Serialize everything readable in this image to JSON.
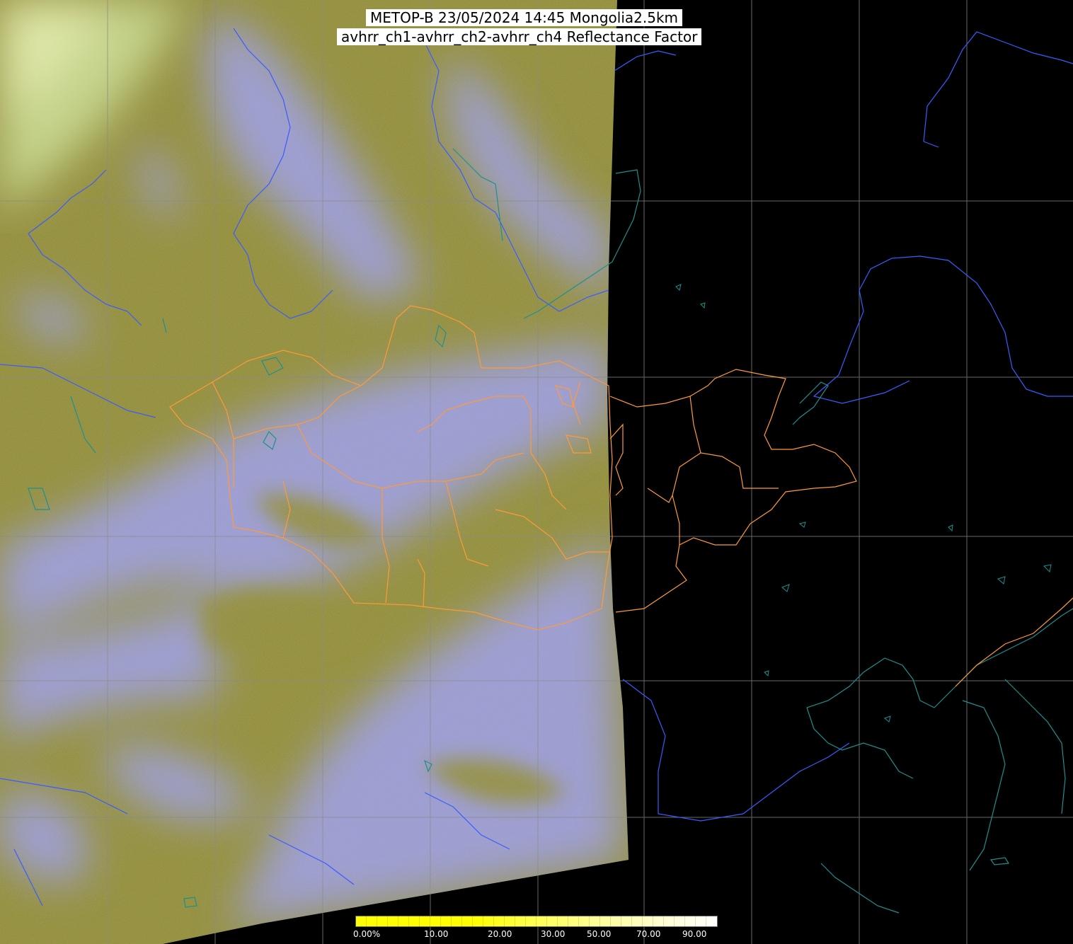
{
  "header": {
    "line1": "METOP-B 23/05/2024 14:45 Mongolia2.5km",
    "line2": "avhrr_ch1-avhrr_ch2-avhrr_ch4 Reflectance Factor"
  },
  "colors": {
    "land_olive": "#8f8a2a",
    "cloud_lavender": "#9a9cf4",
    "bright_cloud": "#d6e6a0",
    "no_data": "#000000",
    "graticule": "#8a8a8a",
    "borders_admin": "#ff9a3a",
    "rivers": "#3a5cff",
    "coast_lakes": "#1f8f8f"
  },
  "legend": {
    "labels": [
      "0.00%",
      "10.00",
      "20.00",
      "30.00",
      "50.00",
      "70.00",
      "90.00"
    ],
    "colors": [
      "#ffff00",
      "#ffff00",
      "#ffff00",
      "#ffff55",
      "#ffff99",
      "#ffffcc",
      "#ffffff"
    ]
  }
}
